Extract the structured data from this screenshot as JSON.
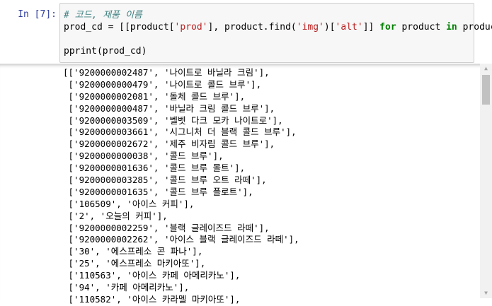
{
  "cell": {
    "prompt": "In [7]:",
    "code": {
      "comment": "# 코드, 제품 이름",
      "line2_a": "prod_cd = [[product[",
      "line2_s1": "'prod'",
      "line2_b": "], product.find(",
      "line2_s2": "'img'",
      "line2_c": ")[",
      "line2_s3": "'alt'",
      "line2_d": "]] ",
      "line2_kw1": "for",
      "line2_e": " product ",
      "line2_kw2": "in",
      "line2_f": " products]",
      "line4": "pprint(prod_cd)"
    }
  },
  "output": {
    "lines": [
      "[['9200000002487', '나이트로 바닐라 크림'],",
      " ['9200000000479', '나이트로 콜드 브루'],",
      " ['9200000002081', '돌체 콜드 브루'],",
      " ['9200000000487', '바닐라 크림 콜드 브루'],",
      " ['9200000003509', '벨벳 다크 모카 나이트로'],",
      " ['9200000003661', '시그니처 더 블랙 콜드 브루'],",
      " ['9200000002672', '제주 비자림 콜드 브루'],",
      " ['9200000000038', '콜드 브루'],",
      " ['9200000001636', '콜드 브루 몰트'],",
      " ['9200000003285', '콜드 브루 오트 라떼'],",
      " ['9200000001635', '콜드 브루 플로트'],",
      " ['106509', '아이스 커피'],",
      " ['2', '오늘의 커피'],",
      " ['9200000002259', '블랙 글레이즈드 라떼'],",
      " ['9200000002262', '아이스 블랙 글레이즈드 라떼'],",
      " ['30', '에스프레소 콘 파나'],",
      " ['25', '에스프레소 마키아또'],",
      " ['110563', '아이스 카페 아메리카노'],",
      " ['94', '카페 아메리카노'],",
      " ['110582', '아이스 카라멜 마키아또'],"
    ]
  },
  "scrollbar": {
    "up_icon": "▲",
    "down_icon": "▼"
  }
}
